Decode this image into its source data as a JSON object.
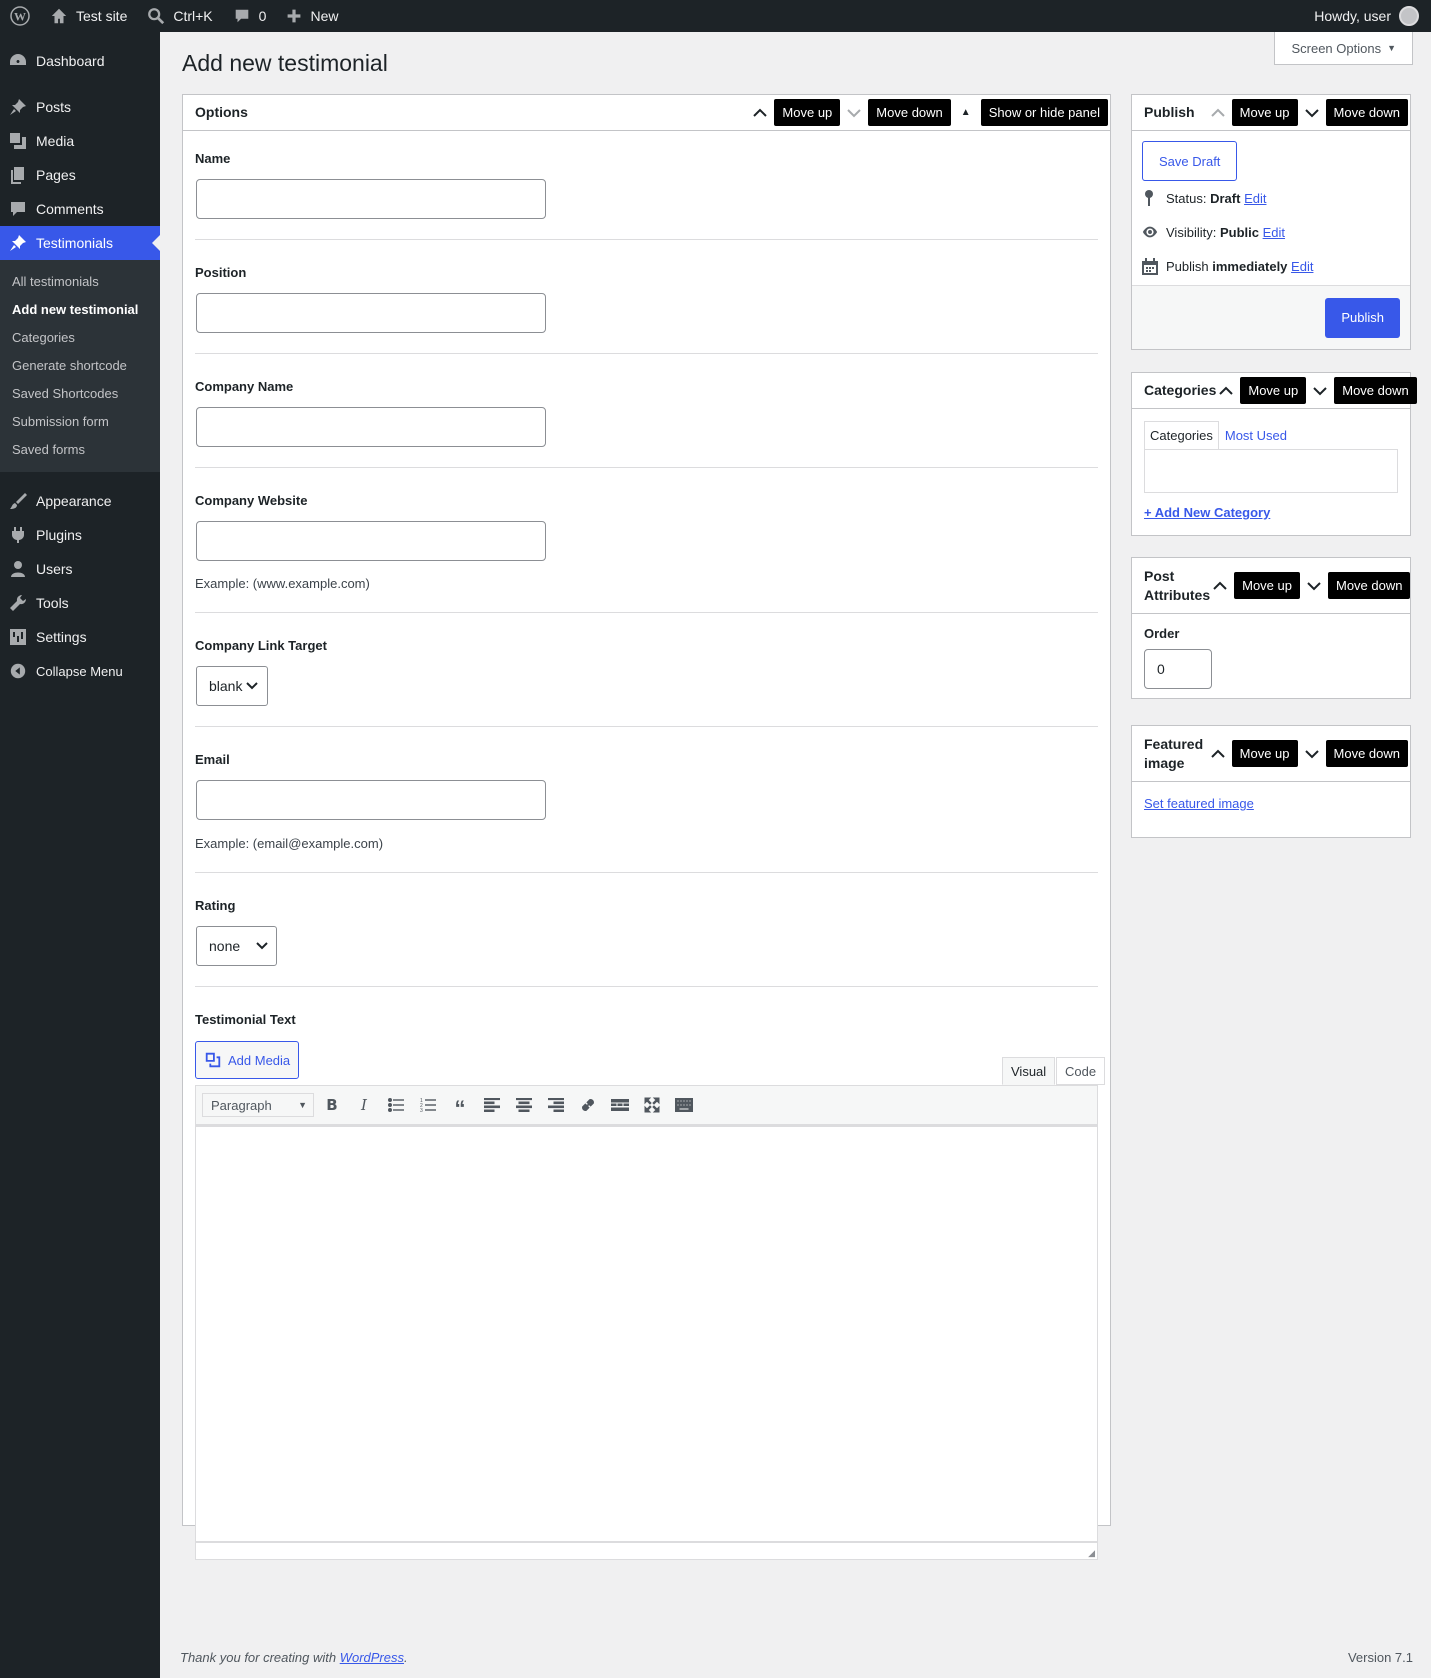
{
  "adminbar": {
    "site_name": "Test site",
    "search_shortcut": "Ctrl+K",
    "comments_count": "0",
    "new_label": "New",
    "howdy": "Howdy, user"
  },
  "sidebar": {
    "items": [
      {
        "label": "Dashboard",
        "icon": "dashboard-icon"
      },
      {
        "label": "Posts",
        "icon": "pin-icon"
      },
      {
        "label": "Media",
        "icon": "media-icon"
      },
      {
        "label": "Pages",
        "icon": "pages-icon"
      },
      {
        "label": "Comments",
        "icon": "comment-icon"
      },
      {
        "label": "Testimonials",
        "icon": "pin-icon"
      },
      {
        "label": "Appearance",
        "icon": "brush-icon"
      },
      {
        "label": "Plugins",
        "icon": "plug-icon"
      },
      {
        "label": "Users",
        "icon": "user-icon"
      },
      {
        "label": "Tools",
        "icon": "wrench-icon"
      },
      {
        "label": "Settings",
        "icon": "settings-icon"
      },
      {
        "label": "Collapse Menu",
        "icon": "collapse-icon"
      }
    ],
    "submenu": [
      "All testimonials",
      "Add new testimonial",
      "Categories",
      "Generate shortcode",
      "Saved Shortcodes",
      "Submission form",
      "Saved forms"
    ]
  },
  "page": {
    "title": "Add new testimonial",
    "screen_options": "Screen Options"
  },
  "tooltips": {
    "move_up": "Move up",
    "move_down": "Move down",
    "show_hide": "Show or hide panel"
  },
  "options": {
    "title": "Options",
    "name_label": "Name",
    "position_label": "Position",
    "company_name_label": "Company Name",
    "company_website_label": "Company Website",
    "company_website_help": "Example: (www.example.com)",
    "link_target_label": "Company Link Target",
    "link_target_value": "blank",
    "email_label": "Email",
    "email_help": "Example: (email@example.com)",
    "rating_label": "Rating",
    "rating_value": "none",
    "testimonial_text_label": "Testimonial Text"
  },
  "editor": {
    "add_media": "Add Media",
    "tab_visual": "Visual",
    "tab_code": "Code",
    "format": "Paragraph"
  },
  "publish": {
    "title": "Publish",
    "save_draft": "Save Draft",
    "status_label": "Status:",
    "status_value": "Draft",
    "visibility_label": "Visibility:",
    "visibility_value": "Public",
    "publish_label": "Publish",
    "publish_value": "immediately",
    "edit": "Edit",
    "publish_button": "Publish"
  },
  "categories": {
    "title": "Categories",
    "tab_all": "Categories",
    "tab_most_used": "Most Used",
    "add_new": "+ Add New Category"
  },
  "attributes": {
    "title_line1": "Post",
    "title_line2": "Attributes",
    "order_label": "Order",
    "order_value": "0"
  },
  "featured": {
    "title_line1": "Featured",
    "title_line2": "image",
    "set_link": "Set featured image"
  },
  "footer": {
    "thanks": "Thank you for creating with ",
    "wp_link": "WordPress",
    "version": "Version 7.1"
  },
  "colors": {
    "accent": "#3858e9",
    "sidebar_bg": "#1d2327",
    "page_bg": "#f0f0f1"
  }
}
